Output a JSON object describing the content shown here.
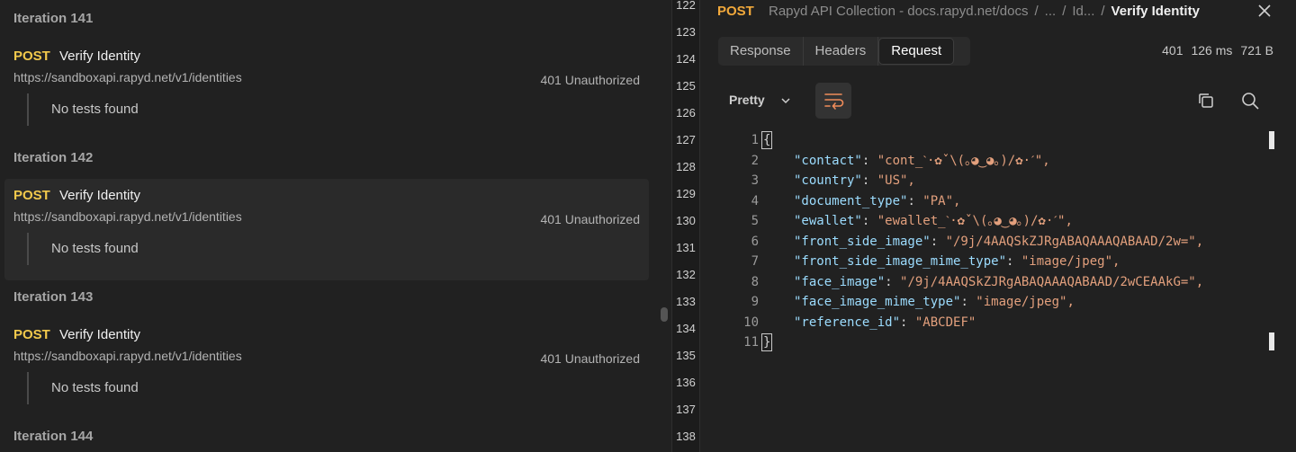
{
  "left": {
    "iterations": [
      {
        "title": "Iteration 141"
      },
      {
        "title": "Iteration 142"
      },
      {
        "title": "Iteration 143"
      },
      {
        "title": "Iteration 144"
      }
    ],
    "requests": [
      {
        "method": "POST",
        "name": "Verify Identity",
        "url": "https://sandboxapi.rapyd.net/v1/identities",
        "status": "401 Unauthorized",
        "tests": "No tests found"
      },
      {
        "method": "POST",
        "name": "Verify Identity",
        "url": "https://sandboxapi.rapyd.net/v1/identities",
        "status": "401 Unauthorized",
        "tests": "No tests found"
      },
      {
        "method": "POST",
        "name": "Verify Identity",
        "url": "https://sandboxapi.rapyd.net/v1/identities",
        "status": "401 Unauthorized",
        "tests": "No tests found"
      }
    ]
  },
  "gutter": {
    "lines": [
      "122",
      "123",
      "124",
      "125",
      "126",
      "127",
      "128",
      "129",
      "130",
      "131",
      "132",
      "133",
      "134",
      "135",
      "136",
      "137",
      "138"
    ]
  },
  "right": {
    "method": "POST",
    "breadcrumb": [
      "Rapyd API Collection - docs.rapyd.net/docs",
      "...",
      "Id..."
    ],
    "current": "Verify Identity",
    "tabs": [
      "Response",
      "Headers",
      "Request"
    ],
    "active_tab": "Request",
    "status_code": "401",
    "time": "126 ms",
    "size": "721 B",
    "format": "Pretty",
    "code": [
      {
        "n": "1",
        "k": "",
        "v": ""
      },
      {
        "n": "2",
        "k": "\"contact\"",
        "v": "\"cont_ˋ·✿ˇ\\(｡◕‿◕｡)/✿·ˊ\","
      },
      {
        "n": "3",
        "k": "\"country\"",
        "v": "\"US\","
      },
      {
        "n": "4",
        "k": "\"document_type\"",
        "v": "\"PA\","
      },
      {
        "n": "5",
        "k": "\"ewallet\"",
        "v": "\"ewallet_ˋ·✿ˇ\\(｡◕‿◕｡)/✿·ˊ\","
      },
      {
        "n": "6",
        "k": "\"front_side_image\"",
        "v": "\"/9j/4AAQSkZJRgABAQAAAQABAAD/2w=\","
      },
      {
        "n": "7",
        "k": "\"front_side_image_mime_type\"",
        "v": "\"image/jpeg\","
      },
      {
        "n": "8",
        "k": "\"face_image\"",
        "v": "\"/9j/4AAQSkZJRgABAQAAAQABAAD/2wCEAAkG=\","
      },
      {
        "n": "9",
        "k": "\"face_image_mime_type\"",
        "v": "\"image/jpeg\","
      },
      {
        "n": "10",
        "k": "\"reference_id\"",
        "v": "\"ABCDEF\""
      },
      {
        "n": "11",
        "k": "",
        "v": ""
      }
    ],
    "open_brace": "{",
    "close_brace": "}"
  },
  "colors": {
    "post": "#f2c94c",
    "json_key": "#9cdcfe",
    "json_string": "#e3a07d"
  }
}
